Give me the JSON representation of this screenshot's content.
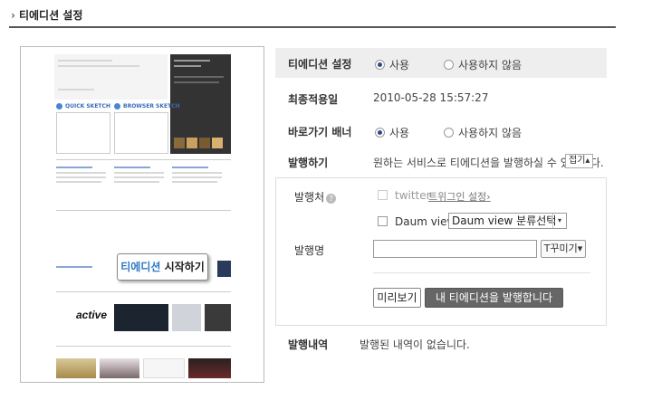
{
  "page": {
    "title": "티에디션 설정",
    "title_arrow": "›"
  },
  "preview": {
    "start_button_prefix": "티에디션",
    "start_button_suffix": " 시작하기",
    "active_logo": "active"
  },
  "settings": {
    "tedition": {
      "label": "티에디션 설정",
      "options": [
        "사용",
        "사용하지 않음"
      ],
      "selected": "사용"
    },
    "last_applied": {
      "label": "최종적용일",
      "value": "2010-05-28 15:57:27"
    },
    "shortcut_banner": {
      "label": "바로가기 배너",
      "options": [
        "사용",
        "사용하지 않음"
      ],
      "selected": "사용"
    },
    "publish": {
      "label": "발행하기",
      "description": "원하는 서비스로 티에디션을 발행하실 수 있습니다.",
      "fold_button": "접기▴"
    },
    "publish_box": {
      "target_label": "발행처",
      "help_icon": "?",
      "twitter_label": "twitter",
      "twitter_login_link": "트위그인 설정",
      "twitter_login_arrow": "›",
      "daum_label": "Daum view",
      "daum_category": "Daum view 분류선택",
      "daum_caret": "▾",
      "name_label": "발행명",
      "name_value": "",
      "decorate_button": "T꾸미기▾",
      "preview_button": "미리보기",
      "publish_button": "내 티에디션을 발행합니다"
    },
    "history": {
      "label": "발행내역",
      "value": "발행된 내역이 없습니다."
    }
  }
}
